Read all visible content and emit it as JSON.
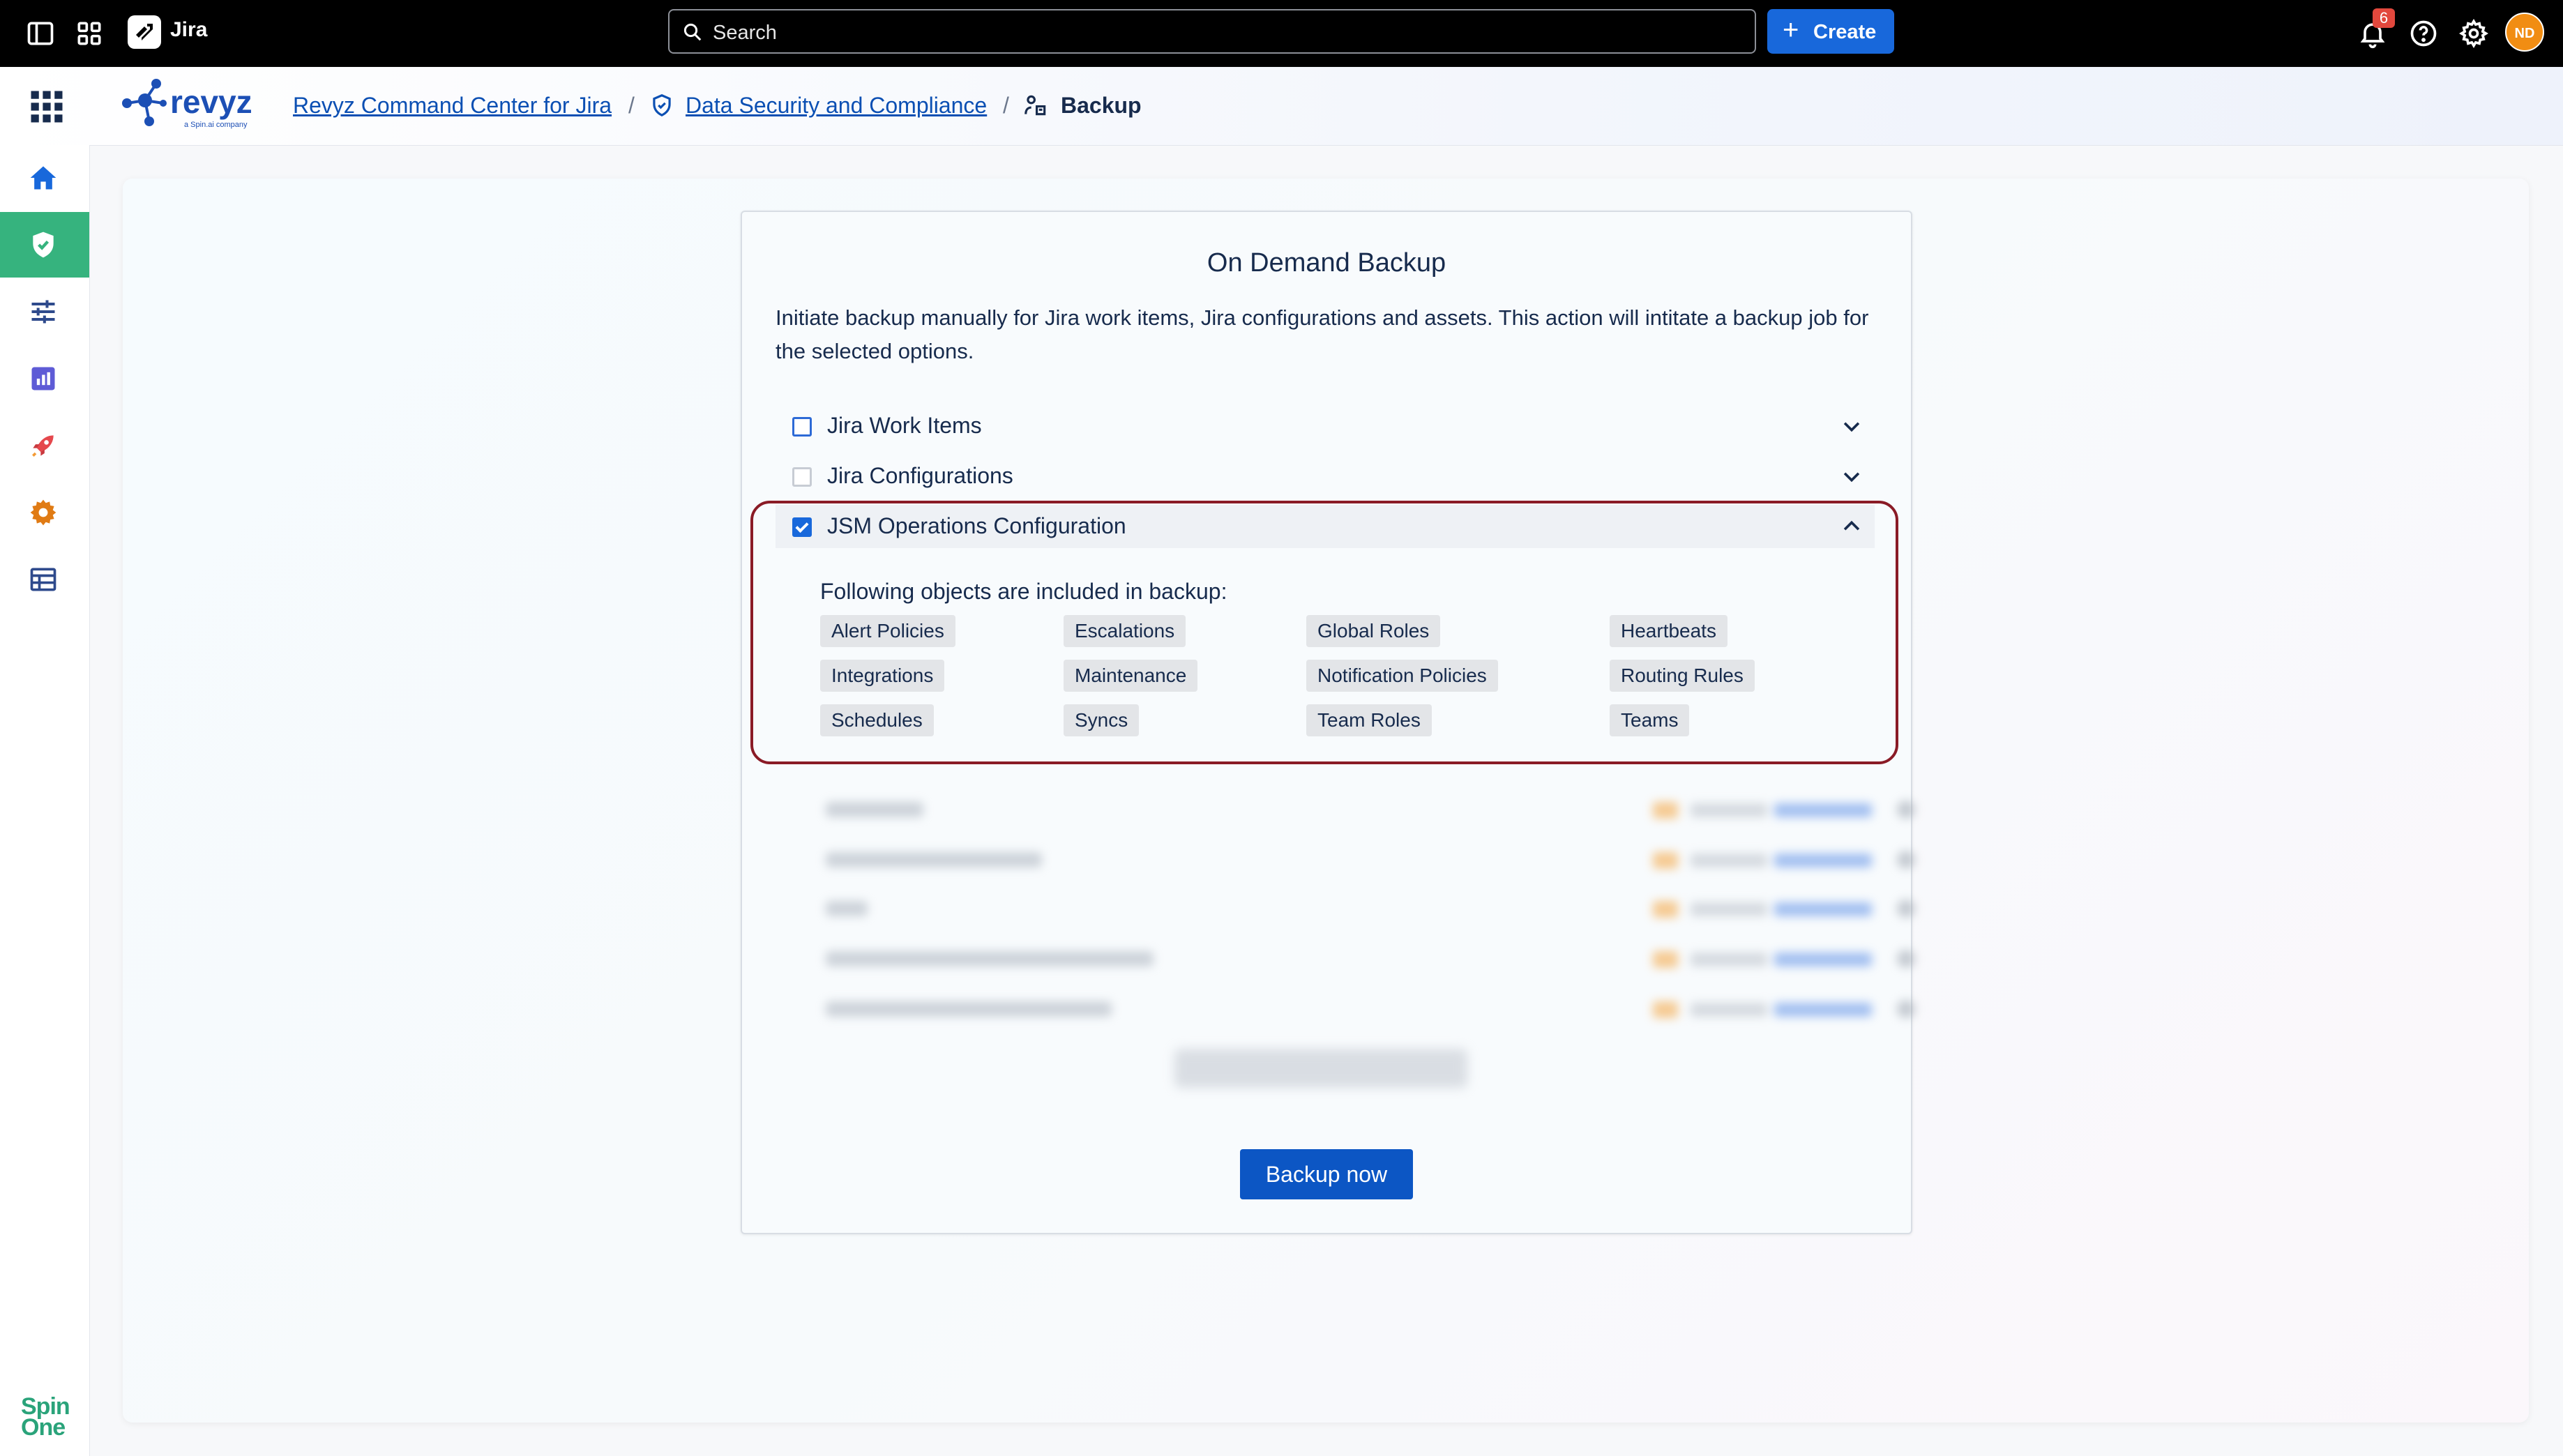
{
  "topbar": {
    "app_name": "Jira",
    "search_placeholder": "Search",
    "create_label": "Create",
    "notification_count": "6",
    "avatar_initials": "ND"
  },
  "breadcrumb": {
    "items": [
      "Revyz Command Center for Jira",
      "Data Security and Compliance",
      "Backup"
    ],
    "separator": "/"
  },
  "sidebar": {
    "items": [
      "home-icon",
      "shield-icon",
      "sliders-icon",
      "chart-icon",
      "rocket-icon",
      "gear-icon",
      "table-icon"
    ],
    "active_index": 1,
    "footer_logo_lines": [
      "Spin",
      "One"
    ]
  },
  "backup": {
    "title": "On Demand Backup",
    "description": "Initiate backup manually for Jira work items, Jira configurations and assets. This action will intitate a backup job for the selected options.",
    "sections": [
      {
        "label": "Jira Work Items",
        "checked": false,
        "expanded": false
      },
      {
        "label": "Jira Configurations",
        "checked": false,
        "expanded": false
      },
      {
        "label": "JSM Operations Configuration",
        "checked": true,
        "expanded": true
      }
    ],
    "objects_heading": "Following objects are included in backup:",
    "objects": [
      "Alert Policies",
      "Escalations",
      "Global Roles",
      "Heartbeats",
      "Integrations",
      "Maintenance",
      "Notification Policies",
      "Routing Rules",
      "Schedules",
      "Syncs",
      "Team Roles",
      "Teams"
    ],
    "button_label": "Backup now"
  },
  "colors": {
    "brand_blue": "#1868db",
    "active_sidebar": "#36b37e",
    "highlight_border": "#8a1b26",
    "avatar": "#f18d13"
  }
}
